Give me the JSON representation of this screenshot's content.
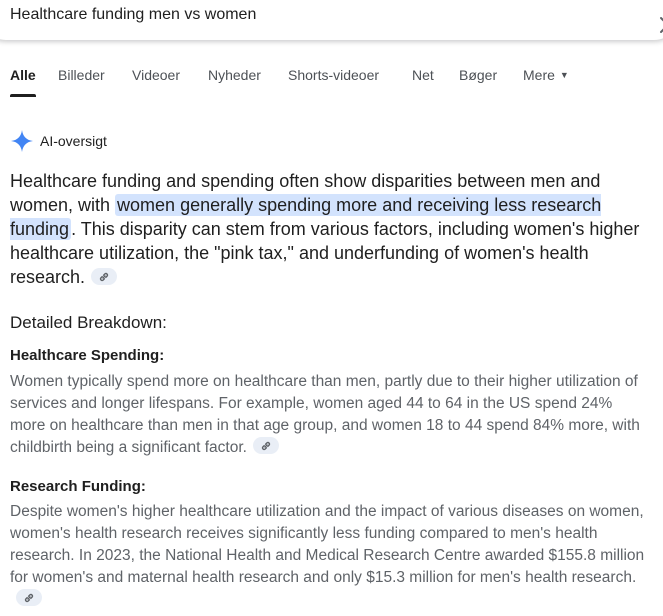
{
  "search": {
    "query": "Healthcare funding men vs women"
  },
  "tabs": [
    {
      "label": "Alle",
      "active": true
    },
    {
      "label": "Billeder"
    },
    {
      "label": "Videoer"
    },
    {
      "label": "Nyheder"
    },
    {
      "label": "Shorts-videoer"
    },
    {
      "label": "Net"
    },
    {
      "label": "Bøger"
    },
    {
      "label": "Mere",
      "has_dropdown": true
    }
  ],
  "ai_overview": {
    "label": "AI-oversigt",
    "summary_before": "Healthcare funding and spending often show disparities between men and women, with ",
    "summary_highlight": "women generally spending more and receiving less research funding",
    "summary_after": ". This disparity can stem from various factors, including women's higher healthcare utilization, the \"pink tax,\" and underfunding of women's health research.",
    "breakdown_title": "Detailed Breakdown:",
    "sections": [
      {
        "title": "Healthcare Spending:",
        "body": "Women typically spend more on healthcare than men, partly due to their higher utilization of services and longer lifespans. For example, women aged 44 to 64 in the US spend 24% more on healthcare than men in that age group, and women 18 to 44 spend 84% more, with childbirth being a significant factor."
      },
      {
        "title": "Research Funding:",
        "body": "Despite women's higher healthcare utilization and the impact of various diseases on women, women's health research receives significantly less funding compared to men's health research. In 2023, the National Health and Medical Research Centre awarded $155.8 million for women's and maternal health research and only $15.3 million for men's health research."
      }
    ]
  },
  "colors": {
    "highlight": "#d3e3fd",
    "ai_icon": "#4285f4",
    "body_text": "#1f1f1f",
    "secondary_text": "#5f6368"
  },
  "icons": [
    "close-icon",
    "ai-sparkle-icon",
    "link-icon",
    "dropdown-caret-icon"
  ]
}
